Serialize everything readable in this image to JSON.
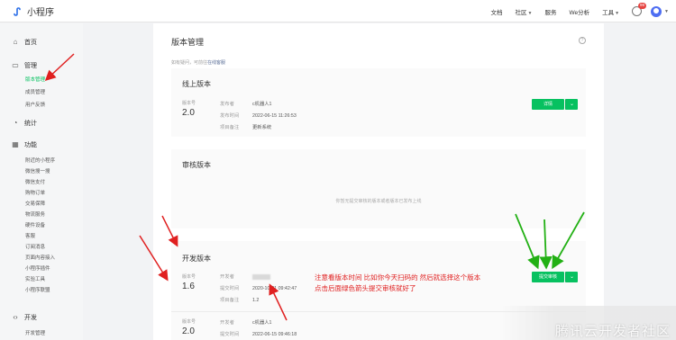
{
  "app": {
    "name": "小程序"
  },
  "topnav": {
    "docs": "文档",
    "community": "社区",
    "service": "服务",
    "we_analysis": "We分析",
    "tools": "工具",
    "notification_count": "99"
  },
  "sidebar": {
    "home": "首页",
    "manage": "管理",
    "manage_items": [
      "版本管理",
      "成员管理",
      "用户反馈"
    ],
    "stats": "统计",
    "features": "功能",
    "feature_items": [
      "附近的小程序",
      "微信搜一搜",
      "微信支付",
      "购物订单",
      "交易保障",
      "物流服务",
      "硬件设备",
      "客服",
      "订阅消息",
      "页面内容接入",
      "小程序插件",
      "实验工具",
      "小程序联盟"
    ],
    "dev": "开发",
    "dev_items": [
      "开发管理"
    ]
  },
  "main": {
    "title": "版本管理",
    "hint_prefix": "如有疑问，可前往",
    "hint_link": "在线客服",
    "labels": {
      "version_no": "版本号",
      "publisher": "发布者",
      "publish_time": "发布时间",
      "project_note": "项目备注",
      "developer": "开发者",
      "submit_time": "提交时间"
    },
    "online": {
      "title": "线上版本",
      "version": "2.0",
      "publisher": "c机器人1",
      "publish_time": "2022-06-15 11:26:53",
      "note": "更新系统",
      "button": "详情"
    },
    "review": {
      "title": "审核版本",
      "empty": "你暂无提交审核的版本或者版本已发布上线"
    },
    "dev": {
      "title": "开发版本",
      "v1": {
        "version": "1.6",
        "submit_time": "2020-10-31 09:42:47",
        "note": "1.2"
      },
      "submit_button": "提交审核",
      "v2": {
        "version": "2.0",
        "developer": "c机器人1",
        "submit_time": "2022-06-15 09:46:18"
      }
    }
  },
  "annotation": {
    "line1": "注意看版本时间 比如你今天扫码的  然后就选择这个版本",
    "line2": "点击后面绿色箭头提交审核就好了"
  },
  "watermark": {
    "text": "腾讯云开发者社区"
  },
  "colors": {
    "brand_green": "#07c160",
    "annotation_red": "#e02020",
    "arrow_green": "#22b014"
  }
}
